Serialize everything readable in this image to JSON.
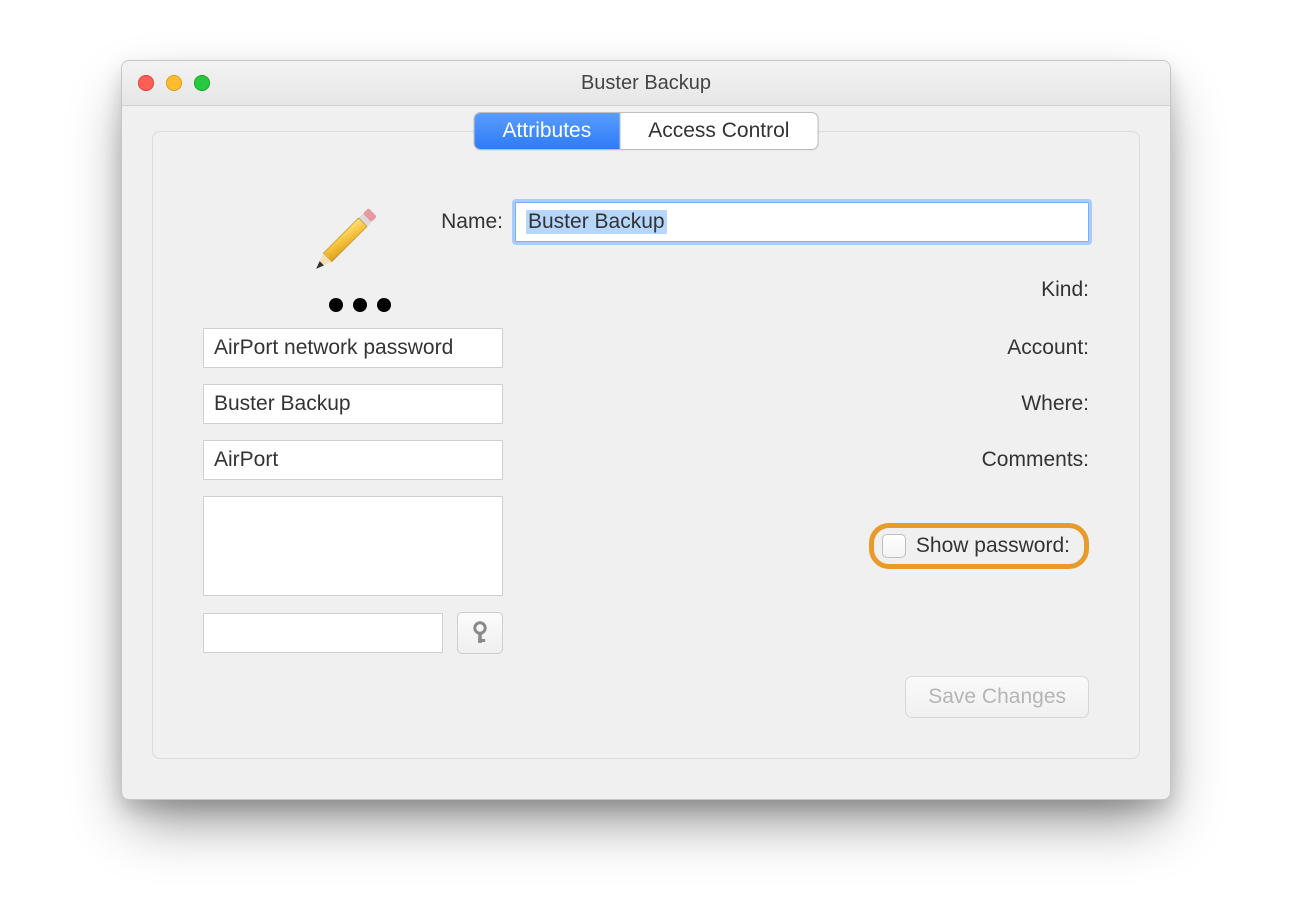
{
  "window": {
    "title": "Buster Backup"
  },
  "tabs": {
    "attributes": "Attributes",
    "access_control": "Access Control",
    "active": "attributes"
  },
  "icon": {
    "name": "pencil-password-icon"
  },
  "fields": {
    "name": {
      "label": "Name:",
      "value": "Buster Backup"
    },
    "kind": {
      "label": "Kind:",
      "value": "AirPort network password"
    },
    "account": {
      "label": "Account:",
      "value": "Buster Backup"
    },
    "where": {
      "label": "Where:",
      "value": "AirPort"
    },
    "comments": {
      "label": "Comments:",
      "value": ""
    }
  },
  "show_password": {
    "label": "Show password:",
    "checked": false
  },
  "password": {
    "value": ""
  },
  "buttons": {
    "save_changes": "Save Changes"
  },
  "annotation": {
    "highlight": "show-password"
  }
}
